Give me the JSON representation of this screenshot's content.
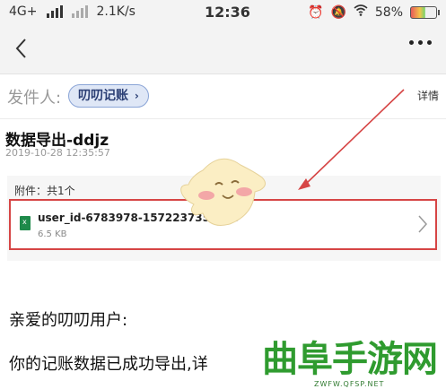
{
  "status_bar": {
    "network": "4G+",
    "speed": "2.1K/s",
    "time": "12:36",
    "battery": "58%"
  },
  "sender": {
    "label": "发件人:",
    "name": "叨叨记账",
    "detail": "详情"
  },
  "email": {
    "subject": "数据导出-ddjz",
    "date": "2019-10-28 12:35:57"
  },
  "attachments": {
    "title": "附件：共1个",
    "file_name": "user_id-6783978-1572237354.xls",
    "file_size": "6.5 KB"
  },
  "body": {
    "greeting": "亲爱的叨叨用户:",
    "line1": "你的记账数据已成功导出,详"
  },
  "watermark": {
    "title": "曲阜手游网",
    "url": "ZWFW.QFSP.NET"
  },
  "colors": {
    "highlight_red": "#d64545",
    "chip_bg": "#dfe7f6",
    "watermark_green": "#2f9b2f"
  }
}
